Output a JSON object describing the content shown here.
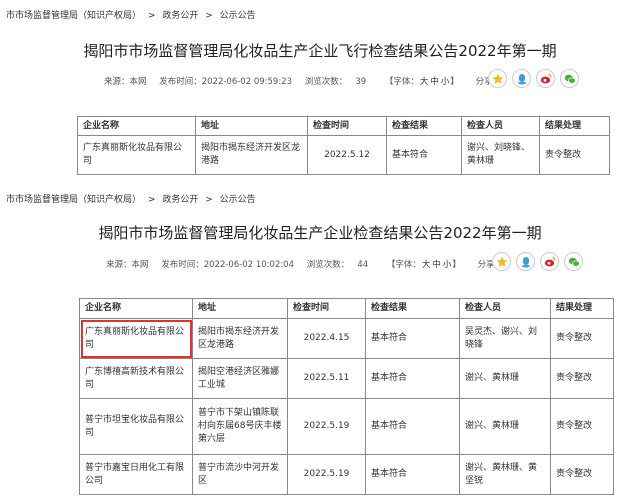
{
  "section1": {
    "breadcrumb": [
      "市市场监督管理局（知识产权局）",
      "政务公开",
      "公示公告"
    ],
    "title": "揭阳市市场监督管理局化妆品生产企业飞行检查结果公告2022年第一期",
    "meta": {
      "source_label": "来源：本网",
      "publish_label": "发布时间：2022-06-02 09:59:23",
      "views_label": "浏览次数：",
      "views_value": "39",
      "font_open": "【字体：",
      "font_l": "大",
      "font_m": "中",
      "font_s": "小",
      "font_close": "】",
      "share_label": "分享到："
    },
    "table": {
      "headers": [
        "企业名称",
        "地址",
        "检查时间",
        "检查结果",
        "检查人员",
        "结果处理"
      ],
      "rows": [
        [
          "广东真丽斯化妆品有限公司",
          "揭阳市揭东经济开发区龙港路",
          "2022.5.12",
          "基本符合",
          "谢兴、刘晓锋、黄林珊",
          "责令整改"
        ]
      ]
    }
  },
  "section2": {
    "breadcrumb": [
      "市市场监督管理局（知识产权局）",
      "政务公开",
      "公示公告"
    ],
    "title": "揭阳市市场监督管理局化妆品生产企业检查结果公告2022年第一期",
    "meta": {
      "source_label": "来源：本网",
      "publish_label": "发布时间：2022-06-02 10:02:04",
      "views_label": "浏览次数：",
      "views_value": "44",
      "font_open": "【字体：",
      "font_l": "大",
      "font_m": "中",
      "font_s": "小",
      "font_close": "】",
      "share_label": "分享到："
    },
    "table": {
      "headers": [
        "企业名称",
        "地址",
        "检查时间",
        "检查结果",
        "检查人员",
        "结果处理"
      ],
      "rows": [
        [
          "广东真丽斯化妆品有限公司",
          "揭阳市揭东经济开发区龙港路",
          "2022.4.15",
          "基本符合",
          "吴灵杰、谢兴、刘晓锋",
          "责令整改"
        ],
        [
          "广东博禧高新技术有限公司",
          "揭阳空港经济区雅娜工业城",
          "2022.5.11",
          "基本符合",
          "谢兴、黄林珊",
          "责令整改"
        ],
        [
          "普宁市坦宝化妆品有限公司",
          "普宁市下架山镇陈联村向东届68号庆丰楼第六层",
          "2022.5.19",
          "基本符合",
          "谢兴、黄林珊",
          "责令整改"
        ],
        [
          "普宁市嘉宝日用化工有限公司",
          "普宁市流沙中河开发区",
          "2022.5.19",
          "基本符合",
          "谢兴、黄林珊、黄坚锐",
          "责令整改"
        ]
      ]
    }
  },
  "colors": {
    "highlight": "#e0332f",
    "qzone": "#f3b61f",
    "qq": "#3a9fe0",
    "weibo": "#e6162d",
    "wechat": "#4cae3c"
  },
  "icons": [
    "qzone-icon",
    "qq-icon",
    "weibo-icon",
    "wechat-icon"
  ]
}
